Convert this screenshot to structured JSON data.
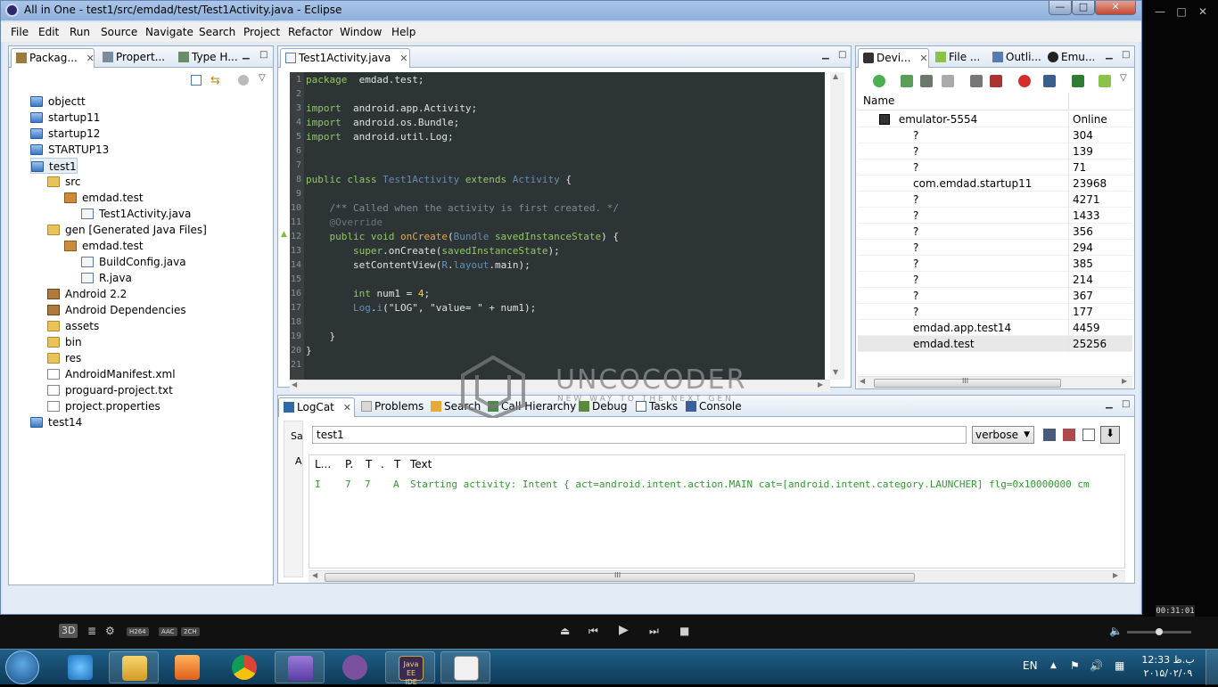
{
  "window": {
    "title": "All in One - test1/src/emdad/test/Test1Activity.java - Eclipse",
    "minimize": "—",
    "maximize": "□",
    "close": "✕"
  },
  "menu": [
    "File",
    "Edit",
    "Run",
    "Source",
    "Navigate",
    "Search",
    "Project",
    "Refactor",
    "Window",
    "Help"
  ],
  "left_panel": {
    "tabs": [
      {
        "label": "Packag...",
        "close": "✕"
      },
      {
        "label": "Propert..."
      },
      {
        "label": "Type H..."
      }
    ],
    "tree": [
      {
        "label": "objectt",
        "icon": "project-icon",
        "depth": 0
      },
      {
        "label": "startup11",
        "icon": "project-icon",
        "depth": 0
      },
      {
        "label": "startup12",
        "icon": "project-icon",
        "depth": 0
      },
      {
        "label": "STARTUP13",
        "icon": "project-icon",
        "depth": 0
      },
      {
        "label": "test1",
        "icon": "open-project-icon",
        "depth": 0
      },
      {
        "label": "src",
        "icon": "source-folder-icon",
        "depth": 1
      },
      {
        "label": "emdad.test",
        "icon": "package-icon",
        "depth": 2
      },
      {
        "label": "Test1Activity.java",
        "icon": "java-file-icon",
        "depth": 3
      },
      {
        "label": "gen [Generated Java Files]",
        "icon": "source-folder-icon",
        "depth": 1
      },
      {
        "label": "emdad.test",
        "icon": "package-icon",
        "depth": 2
      },
      {
        "label": "BuildConfig.java",
        "icon": "java-file-icon",
        "depth": 3
      },
      {
        "label": "R.java",
        "icon": "java-file-icon",
        "depth": 3
      },
      {
        "label": "Android 2.2",
        "icon": "library-icon",
        "depth": 1
      },
      {
        "label": "Android Dependencies",
        "icon": "library-icon",
        "depth": 1
      },
      {
        "label": "assets",
        "icon": "folder-icon",
        "depth": 1
      },
      {
        "label": "bin",
        "icon": "folder-icon",
        "depth": 1
      },
      {
        "label": "res",
        "icon": "folder-icon",
        "depth": 1
      },
      {
        "label": "AndroidManifest.xml",
        "icon": "xml-file-icon",
        "depth": 1
      },
      {
        "label": "proguard-project.txt",
        "icon": "text-file-icon",
        "depth": 1
      },
      {
        "label": "project.properties",
        "icon": "text-file-icon",
        "depth": 1
      },
      {
        "label": "test14",
        "icon": "project-icon",
        "depth": 0
      }
    ]
  },
  "editor": {
    "tab": "Test1Activity.java",
    "close": "✕",
    "lines": [
      {
        "n": "1",
        "parts": [
          [
            "kw",
            "package"
          ],
          [
            "",
            "  emdad.test;"
          ]
        ]
      },
      {
        "n": "2",
        "parts": []
      },
      {
        "n": "3",
        "parts": [
          [
            "kw",
            "import"
          ],
          [
            "",
            "  android.app.Activity;"
          ]
        ]
      },
      {
        "n": "4",
        "parts": [
          [
            "kw",
            "import"
          ],
          [
            "",
            "  android.os.Bundle;"
          ]
        ]
      },
      {
        "n": "5",
        "parts": [
          [
            "kw",
            "import"
          ],
          [
            "",
            "  android.util.Log;"
          ]
        ]
      },
      {
        "n": "6",
        "parts": []
      },
      {
        "n": "7",
        "parts": []
      },
      {
        "n": "8",
        "parts": [
          [
            "kw",
            "public class "
          ],
          [
            "ty",
            "Test1Activity "
          ],
          [
            "kw",
            "extends "
          ],
          [
            "ty",
            "Activity "
          ],
          [
            "",
            "{"
          ]
        ]
      },
      {
        "n": "9",
        "parts": []
      },
      {
        "n": "10",
        "parts": [
          [
            "cm",
            "    /** Called when the activity is first created. */"
          ]
        ]
      },
      {
        "n": "11",
        "parts": [
          [
            "pr",
            "    @Override"
          ]
        ]
      },
      {
        "n": "12",
        "parts": [
          [
            "kw",
            "    public void "
          ],
          [
            "fn",
            "onCreate"
          ],
          [
            "",
            "("
          ],
          [
            "ty",
            "Bundle "
          ],
          [
            "kw",
            "savedInstanceState"
          ],
          [
            "",
            ") {"
          ]
        ]
      },
      {
        "n": "13",
        "parts": [
          [
            "kw",
            "        super"
          ],
          [
            "",
            ".onCreate("
          ],
          [
            "kw",
            "savedInstanceState"
          ],
          [
            "",
            ");"
          ]
        ]
      },
      {
        "n": "14",
        "parts": [
          [
            "",
            "        setContentView("
          ],
          [
            "ty",
            "R"
          ],
          [
            "",
            "."
          ],
          [
            "ty",
            "layout"
          ],
          [
            "",
            ".main);"
          ]
        ]
      },
      {
        "n": "15",
        "parts": []
      },
      {
        "n": "16",
        "parts": [
          [
            "kw",
            "        int "
          ],
          [
            "",
            "num1 = "
          ],
          [
            "num",
            "4"
          ],
          [
            "",
            ";"
          ]
        ]
      },
      {
        "n": "17",
        "parts": [
          [
            "ty",
            "        Log"
          ],
          [
            "",
            "."
          ],
          [
            "ty",
            "i"
          ],
          [
            "",
            "(\"LOG\", \"value= \" + num1);"
          ]
        ]
      },
      {
        "n": "18",
        "parts": []
      },
      {
        "n": "19",
        "parts": [
          [
            "",
            "    }"
          ]
        ]
      },
      {
        "n": "20",
        "parts": [
          [
            "",
            "}"
          ]
        ]
      },
      {
        "n": "21",
        "parts": []
      }
    ]
  },
  "devices": {
    "tabs": [
      {
        "label": "Devi...",
        "close": "✕"
      },
      {
        "label": "File ..."
      },
      {
        "label": "Outli..."
      },
      {
        "label": "Emu..."
      }
    ],
    "header_name": "Name",
    "device": {
      "name": "emulator-5554",
      "status": "Online"
    },
    "processes": [
      {
        "name": "?",
        "pid": "304"
      },
      {
        "name": "?",
        "pid": "139"
      },
      {
        "name": "?",
        "pid": "71"
      },
      {
        "name": "com.emdad.startup11",
        "pid": "23968"
      },
      {
        "name": "?",
        "pid": "4271"
      },
      {
        "name": "?",
        "pid": "1433"
      },
      {
        "name": "?",
        "pid": "356"
      },
      {
        "name": "?",
        "pid": "294"
      },
      {
        "name": "?",
        "pid": "385"
      },
      {
        "name": "?",
        "pid": "214"
      },
      {
        "name": "?",
        "pid": "367"
      },
      {
        "name": "?",
        "pid": "177"
      },
      {
        "name": "emdad.app.test14",
        "pid": "4459"
      },
      {
        "name": "emdad.test",
        "pid": "25256"
      }
    ],
    "scroll_grip": "III"
  },
  "bottom": {
    "tabs": [
      {
        "label": "LogCat",
        "close": "✕"
      },
      {
        "label": "Problems"
      },
      {
        "label": "Search"
      },
      {
        "label": "Call Hierarchy"
      },
      {
        "label": "Debug"
      },
      {
        "label": "Tasks"
      },
      {
        "label": "Console"
      }
    ],
    "side_labels": [
      "Sa",
      "A"
    ],
    "filter_value": "test1",
    "level": "verbose",
    "columns": [
      "L...",
      "P.",
      "T",
      ".",
      "T",
      "Text"
    ],
    "row": {
      "level": "I",
      "pid": "7",
      "tid": "7",
      "app": "A",
      "text": "Starting activity: Intent { act=android.intent.action.MAIN cat=[android.intent.category.LAUNCHER] flg=0x10000000 cm"
    },
    "scroll_grip": "III"
  },
  "watermark": {
    "brand": "UNCOCODER",
    "tagline": "NEW WAY TO THE NEXT GEN"
  },
  "player": {
    "time": "00:31:01",
    "badges": [
      "3D",
      "H264",
      "AAC",
      "2CH"
    ]
  },
  "taskbar": {
    "language": "EN",
    "time": "12:33 ب.ظ",
    "date": "۲۰۱۵/۰۲/۰۹",
    "apps": [
      "internet-explorer",
      "file-explorer",
      "media-player",
      "chrome",
      "visual-studio",
      "viber",
      "eclipse-javaee",
      "notepad"
    ],
    "javaee_label": "Java EE IDE"
  }
}
